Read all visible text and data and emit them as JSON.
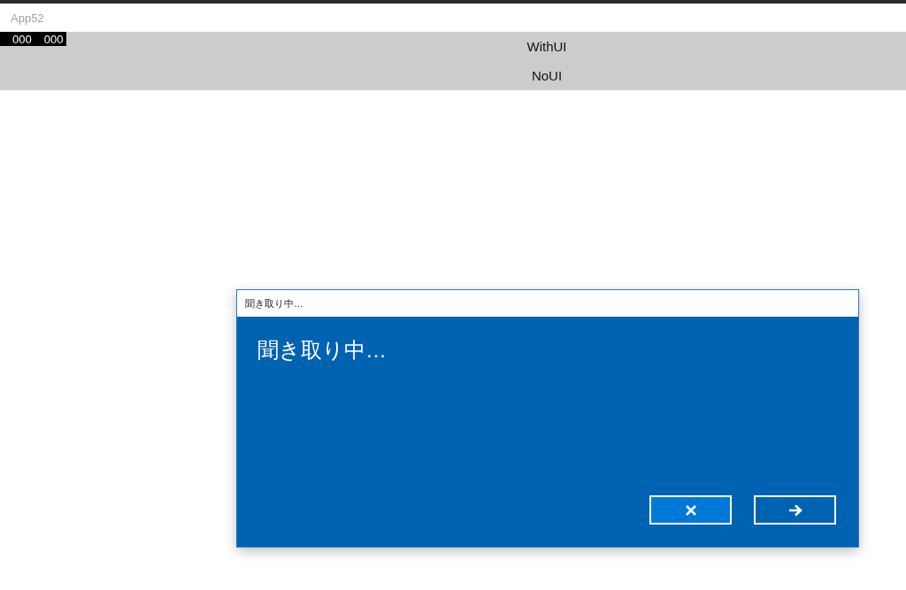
{
  "window": {
    "title": "App52"
  },
  "counter": [
    "000",
    "000"
  ],
  "buttons": [
    {
      "label": "WithUI"
    },
    {
      "label": "NoUI"
    }
  ],
  "dialog": {
    "title": "聞き取り中…",
    "heading": "聞き取り中…",
    "actions": [
      {
        "kind": "cancel",
        "focused": true
      },
      {
        "kind": "next",
        "focused": false
      }
    ]
  }
}
